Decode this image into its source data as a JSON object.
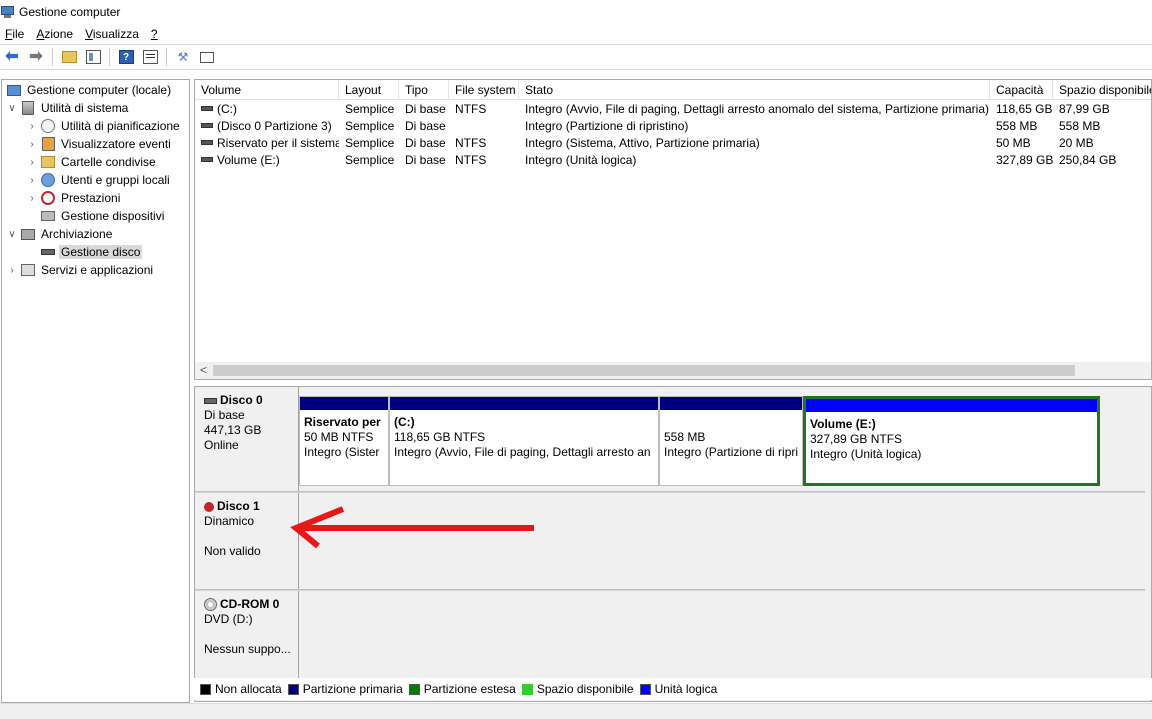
{
  "window": {
    "title": "Gestione computer"
  },
  "menu": [
    {
      "label": "File",
      "key": "F"
    },
    {
      "label": "Azione",
      "key": "A"
    },
    {
      "label": "Visualizza",
      "key": "V"
    },
    {
      "label": "?",
      "key": "?"
    }
  ],
  "toolbar": {
    "buttons": [
      "back-icon",
      "forward-icon",
      "up-folder-icon",
      "show-hide-tree-icon",
      "help-icon",
      "properties-icon",
      "connect-icon",
      "list-view-icon"
    ]
  },
  "tree": {
    "root": "Gestione computer (locale)",
    "system_tools": "Utilità di sistema",
    "task_scheduler": "Utilità di pianificazione",
    "event_viewer": "Visualizzatore eventi",
    "shared_folders": "Cartelle condivise",
    "local_users": "Utenti e gruppi locali",
    "performance": "Prestazioni",
    "device_manager": "Gestione dispositivi",
    "storage": "Archiviazione",
    "disk_management": "Gestione disco",
    "services": "Servizi e applicazioni"
  },
  "volumes": {
    "columns": [
      "Volume",
      "Layout",
      "Tipo",
      "File system",
      "Stato",
      "Capacità",
      "Spazio disponibile"
    ],
    "rows": [
      {
        "volume": "(C:)",
        "layout": "Semplice",
        "tipo": "Di base",
        "fs": "NTFS",
        "stato": "Integro (Avvio, File di paging, Dettagli arresto anomalo del sistema, Partizione primaria)",
        "capacita": "118,65 GB",
        "spazio": "87,99 GB"
      },
      {
        "volume": "(Disco 0 Partizione 3)",
        "layout": "Semplice",
        "tipo": "Di base",
        "fs": "",
        "stato": "Integro (Partizione di ripristino)",
        "capacita": "558 MB",
        "spazio": "558 MB"
      },
      {
        "volume": "Riservato per il sistema",
        "layout": "Semplice",
        "tipo": "Di base",
        "fs": "NTFS",
        "stato": "Integro (Sistema, Attivo, Partizione primaria)",
        "capacita": "50 MB",
        "spazio": "20 MB"
      },
      {
        "volume": "Volume (E:)",
        "layout": "Semplice",
        "tipo": "Di base",
        "fs": "NTFS",
        "stato": "Integro (Unità logica)",
        "capacita": "327,89 GB",
        "spazio": "250,84 GB"
      }
    ],
    "scroll_left": "<"
  },
  "disks": {
    "disk0": {
      "name": "Disco 0",
      "type": "Di base",
      "size": "447,13 GB",
      "status": "Online",
      "partitions": [
        {
          "title": "Riservato per",
          "line2": "50 MB NTFS",
          "line3": "Integro (Sister",
          "color": "#000080"
        },
        {
          "title": "(C:)",
          "line2": "118,65 GB NTFS",
          "line3": "Integro (Avvio, File di paging, Dettagli arresto an",
          "color": "#000080"
        },
        {
          "title": "",
          "line2": "558 MB",
          "line3": "Integro (Partizione di ripri",
          "color": "#000080"
        },
        {
          "title": "Volume  (E:)",
          "line2": "327,89 GB NTFS",
          "line3": "Integro (Unità logica)",
          "color": "#0000ff"
        }
      ]
    },
    "disk1": {
      "name": "Disco 1",
      "type": "Dinamico",
      "status": "Non valido"
    },
    "cdrom0": {
      "name": "CD-ROM 0",
      "type": "DVD (D:)",
      "status": "Nessun suppo..."
    }
  },
  "legend": [
    {
      "label": "Non allocata",
      "color": "#000000"
    },
    {
      "label": "Partizione primaria",
      "color": "#000080"
    },
    {
      "label": "Partizione estesa",
      "color": "#008000"
    },
    {
      "label": "Spazio disponibile",
      "color": "#33cc33"
    },
    {
      "label": "Unità logica",
      "color": "#0000ff"
    }
  ],
  "annotation": {
    "arrow_color": "#e81818"
  }
}
